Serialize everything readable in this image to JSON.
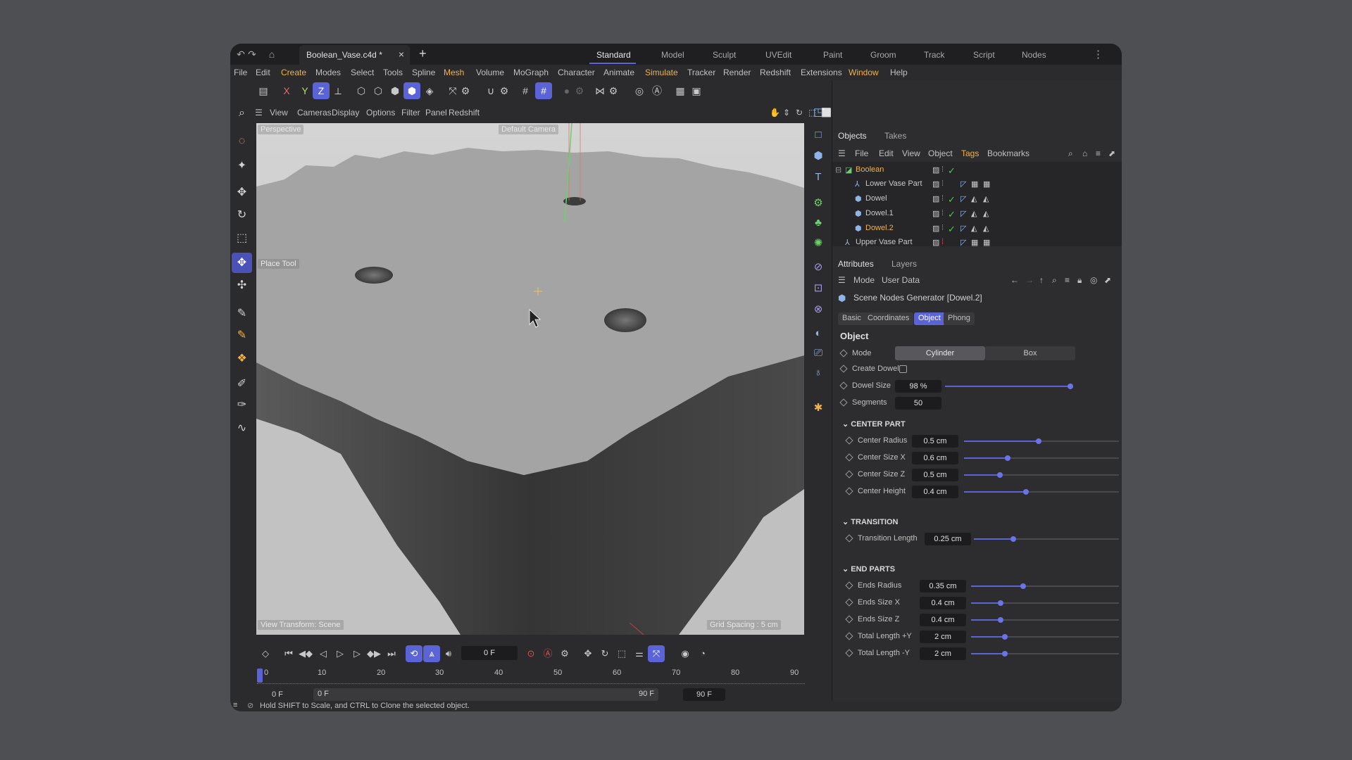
{
  "titlebar": {
    "doc_name": "Boolean_Vase.c4d *",
    "layouts": [
      "Standard",
      "Model",
      "Sculpt",
      "UVEdit",
      "Paint",
      "Groom",
      "Track",
      "Script",
      "Nodes"
    ],
    "active_layout": "Standard"
  },
  "menubar": {
    "items": [
      "File",
      "Edit",
      "Create",
      "Modes",
      "Select",
      "Tools",
      "Spline",
      "Mesh",
      "Volume",
      "MoGraph",
      "Character",
      "Animate",
      "Simulate",
      "Tracker",
      "Render",
      "Redshift",
      "Extensions",
      "Window",
      "Help"
    ]
  },
  "toolbar": {
    "axis_x": "X",
    "axis_y": "Y",
    "axis_z": "Z"
  },
  "viewport": {
    "menu": [
      "View",
      "Cameras",
      "Display",
      "Options",
      "Filter",
      "Panel",
      "Redshift"
    ],
    "label_perspective": "Perspective",
    "label_camera": "Default Camera",
    "label_place_tool": "Place Tool",
    "label_transform": "View Transform: Scene",
    "label_grid": "Grid Spacing : 5 cm"
  },
  "objects_panel": {
    "tabs": [
      "Objects",
      "Takes"
    ],
    "menu": [
      "File",
      "Edit",
      "View",
      "Object",
      "Tags",
      "Bookmarks"
    ],
    "tree": [
      {
        "name": "Boolean",
        "highlight": true,
        "level": 0
      },
      {
        "name": "Lower Vase Part",
        "highlight": false,
        "level": 1
      },
      {
        "name": "Dowel",
        "highlight": false,
        "level": 1
      },
      {
        "name": "Dowel.1",
        "highlight": false,
        "level": 1
      },
      {
        "name": "Dowel.2",
        "highlight": true,
        "level": 1
      },
      {
        "name": "Upper Vase Part",
        "highlight": false,
        "level": 0
      }
    ]
  },
  "attributes_panel": {
    "tabs": [
      "Attributes",
      "Layers"
    ],
    "menu": [
      "Mode",
      "User Data"
    ],
    "object_title": "Scene Nodes Generator [Dowel.2]",
    "subtabs": [
      "Basic",
      "Coordinates",
      "Object",
      "Phong"
    ],
    "active_subtab": "Object",
    "section": "Object",
    "mode_label": "Mode",
    "mode_options": [
      "Cylinder",
      "Box"
    ],
    "mode_selected": "Cylinder",
    "create_dowel_label": "Create Dowel",
    "create_dowel_checked": false,
    "dowel_size_label": "Dowel Size",
    "dowel_size_value": "98 %",
    "dowel_size_fraction": 0.98,
    "segments_label": "Segments",
    "segments_value": "50",
    "center_part": {
      "title": "CENTER PART",
      "rows": [
        {
          "label": "Center Radius",
          "value": "0.5 cm",
          "fraction": 0.48
        },
        {
          "label": "Center Size X",
          "value": "0.6 cm",
          "fraction": 0.28
        },
        {
          "label": "Center Size Z",
          "value": "0.5 cm",
          "fraction": 0.23
        },
        {
          "label": "Center Height",
          "value": "0.4 cm",
          "fraction": 0.4
        }
      ]
    },
    "transition": {
      "title": "TRANSITION",
      "rows": [
        {
          "label": "Transition Length",
          "value": "0.25 cm",
          "fraction": 0.27
        }
      ]
    },
    "end_parts": {
      "title": "END PARTS",
      "rows": [
        {
          "label": "Ends Radius",
          "value": "0.35 cm",
          "fraction": 0.35
        },
        {
          "label": "Ends Size X",
          "value": "0.4 cm",
          "fraction": 0.2
        },
        {
          "label": "Ends Size Z",
          "value": "0.4 cm",
          "fraction": 0.2
        },
        {
          "label": "Total Length +Y",
          "value": "2 cm",
          "fraction": 0.23
        },
        {
          "label": "Total Length -Y",
          "value": "2 cm",
          "fraction": 0.23
        }
      ]
    }
  },
  "timeline": {
    "current_frame": "0 F",
    "ruler": [
      "0",
      "10",
      "20",
      "30",
      "40",
      "50",
      "60",
      "70",
      "80",
      "90"
    ],
    "range_start": "0 F",
    "range_start2": "0 F",
    "range_end": "90 F",
    "range_end2": "90 F"
  },
  "status": {
    "text": "Hold SHIFT to Scale, and CTRL to Clone the selected object."
  },
  "colors": {
    "accent": "#5a64d6",
    "highlight": "#f0b24a",
    "check": "#4ec94e"
  }
}
